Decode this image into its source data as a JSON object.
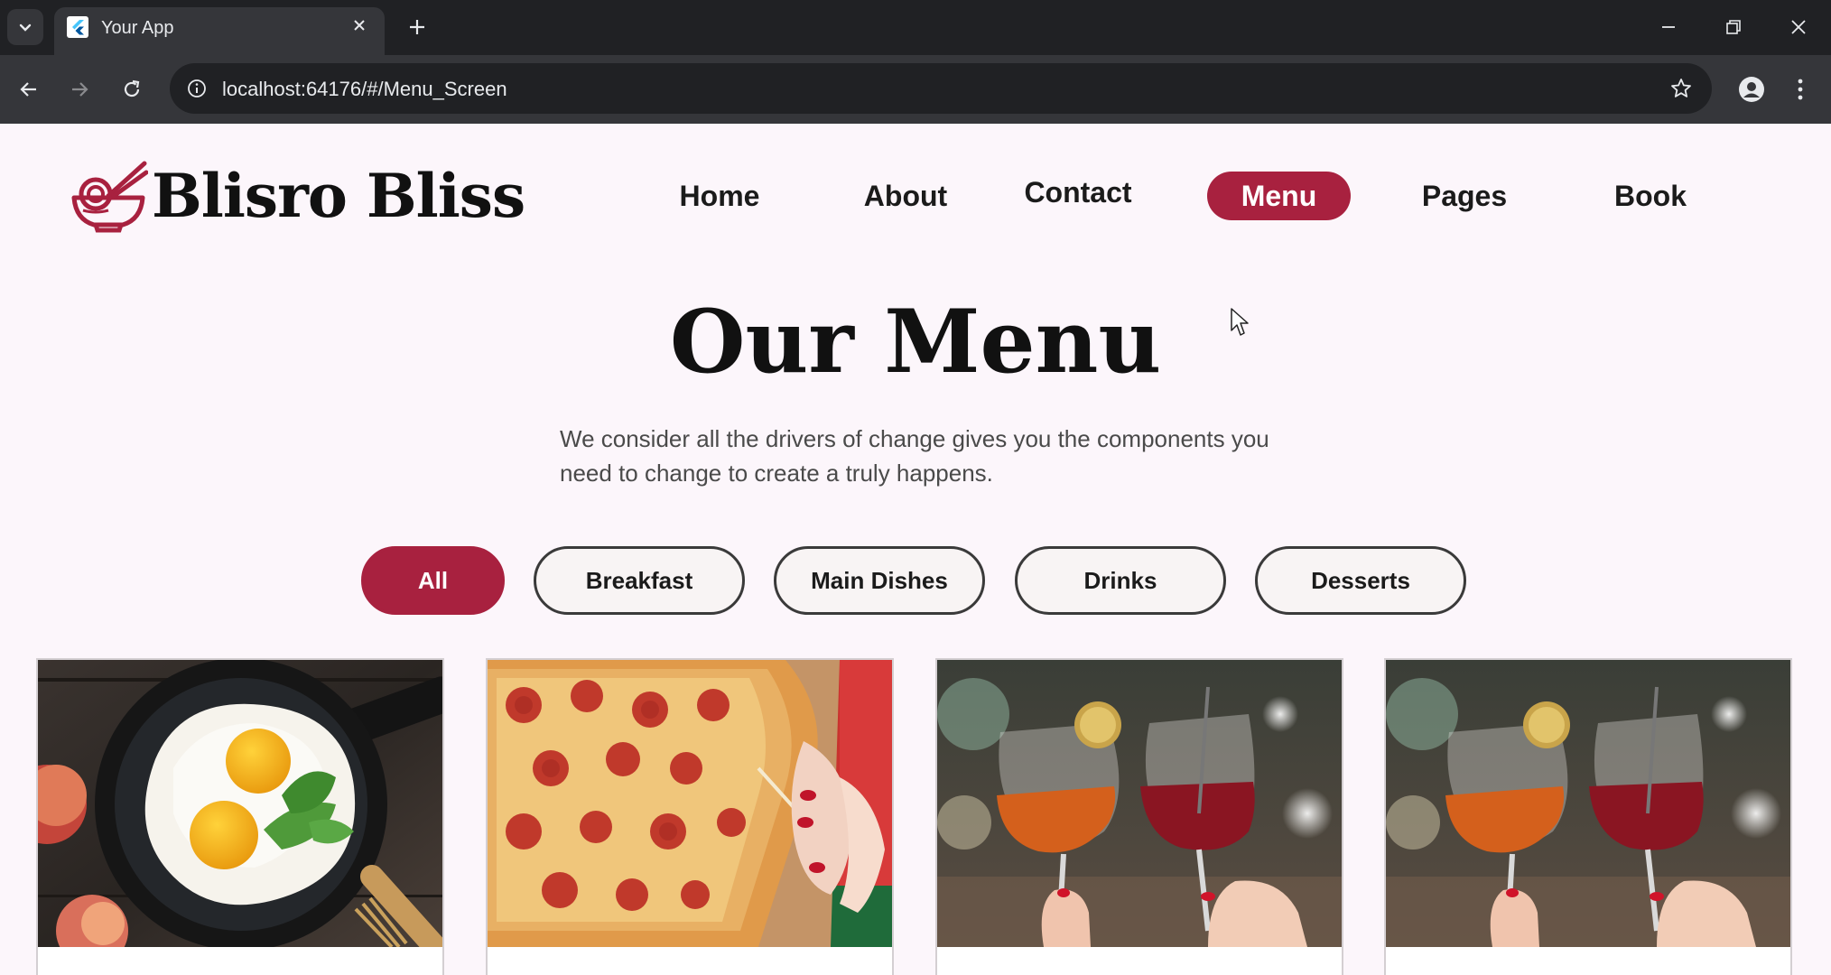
{
  "browser": {
    "tab_title": "Your App",
    "url": "localhost:64176/#/Menu_Screen"
  },
  "site": {
    "brand": "Blisro Bliss",
    "brand_color": "#a8213f",
    "nav": [
      {
        "label": "Home"
      },
      {
        "label": "About"
      },
      {
        "label": "Contact"
      },
      {
        "label": "Menu",
        "active": true
      },
      {
        "label": "Pages"
      },
      {
        "label": "Book"
      }
    ]
  },
  "menu": {
    "title": "Our Menu",
    "description": "We consider all the drivers of change gives you the components you need to change to create a truly happens.",
    "filters": [
      {
        "label": "All",
        "active": true
      },
      {
        "label": "Breakfast"
      },
      {
        "label": "Main Dishes"
      },
      {
        "label": "Drinks"
      },
      {
        "label": "Desserts"
      }
    ],
    "cards": [
      {
        "image": "fried-eggs-pan-photo"
      },
      {
        "image": "pepperoni-pizza-photo"
      },
      {
        "image": "cocktail-glasses-photo"
      },
      {
        "image": "cocktail-glasses-photo"
      }
    ]
  }
}
